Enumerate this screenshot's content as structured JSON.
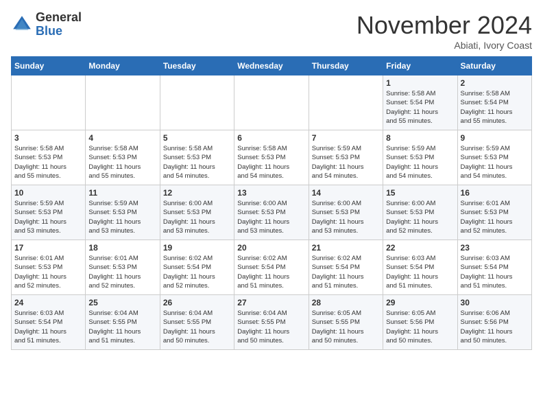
{
  "logo": {
    "general": "General",
    "blue": "Blue"
  },
  "header": {
    "month": "November 2024",
    "location": "Abiati, Ivory Coast"
  },
  "weekdays": [
    "Sunday",
    "Monday",
    "Tuesday",
    "Wednesday",
    "Thursday",
    "Friday",
    "Saturday"
  ],
  "weeks": [
    [
      {
        "day": "",
        "info": ""
      },
      {
        "day": "",
        "info": ""
      },
      {
        "day": "",
        "info": ""
      },
      {
        "day": "",
        "info": ""
      },
      {
        "day": "",
        "info": ""
      },
      {
        "day": "1",
        "info": "Sunrise: 5:58 AM\nSunset: 5:54 PM\nDaylight: 11 hours\nand 55 minutes."
      },
      {
        "day": "2",
        "info": "Sunrise: 5:58 AM\nSunset: 5:54 PM\nDaylight: 11 hours\nand 55 minutes."
      }
    ],
    [
      {
        "day": "3",
        "info": "Sunrise: 5:58 AM\nSunset: 5:53 PM\nDaylight: 11 hours\nand 55 minutes."
      },
      {
        "day": "4",
        "info": "Sunrise: 5:58 AM\nSunset: 5:53 PM\nDaylight: 11 hours\nand 55 minutes."
      },
      {
        "day": "5",
        "info": "Sunrise: 5:58 AM\nSunset: 5:53 PM\nDaylight: 11 hours\nand 54 minutes."
      },
      {
        "day": "6",
        "info": "Sunrise: 5:58 AM\nSunset: 5:53 PM\nDaylight: 11 hours\nand 54 minutes."
      },
      {
        "day": "7",
        "info": "Sunrise: 5:59 AM\nSunset: 5:53 PM\nDaylight: 11 hours\nand 54 minutes."
      },
      {
        "day": "8",
        "info": "Sunrise: 5:59 AM\nSunset: 5:53 PM\nDaylight: 11 hours\nand 54 minutes."
      },
      {
        "day": "9",
        "info": "Sunrise: 5:59 AM\nSunset: 5:53 PM\nDaylight: 11 hours\nand 54 minutes."
      }
    ],
    [
      {
        "day": "10",
        "info": "Sunrise: 5:59 AM\nSunset: 5:53 PM\nDaylight: 11 hours\nand 53 minutes."
      },
      {
        "day": "11",
        "info": "Sunrise: 5:59 AM\nSunset: 5:53 PM\nDaylight: 11 hours\nand 53 minutes."
      },
      {
        "day": "12",
        "info": "Sunrise: 6:00 AM\nSunset: 5:53 PM\nDaylight: 11 hours\nand 53 minutes."
      },
      {
        "day": "13",
        "info": "Sunrise: 6:00 AM\nSunset: 5:53 PM\nDaylight: 11 hours\nand 53 minutes."
      },
      {
        "day": "14",
        "info": "Sunrise: 6:00 AM\nSunset: 5:53 PM\nDaylight: 11 hours\nand 53 minutes."
      },
      {
        "day": "15",
        "info": "Sunrise: 6:00 AM\nSunset: 5:53 PM\nDaylight: 11 hours\nand 52 minutes."
      },
      {
        "day": "16",
        "info": "Sunrise: 6:01 AM\nSunset: 5:53 PM\nDaylight: 11 hours\nand 52 minutes."
      }
    ],
    [
      {
        "day": "17",
        "info": "Sunrise: 6:01 AM\nSunset: 5:53 PM\nDaylight: 11 hours\nand 52 minutes."
      },
      {
        "day": "18",
        "info": "Sunrise: 6:01 AM\nSunset: 5:53 PM\nDaylight: 11 hours\nand 52 minutes."
      },
      {
        "day": "19",
        "info": "Sunrise: 6:02 AM\nSunset: 5:54 PM\nDaylight: 11 hours\nand 52 minutes."
      },
      {
        "day": "20",
        "info": "Sunrise: 6:02 AM\nSunset: 5:54 PM\nDaylight: 11 hours\nand 51 minutes."
      },
      {
        "day": "21",
        "info": "Sunrise: 6:02 AM\nSunset: 5:54 PM\nDaylight: 11 hours\nand 51 minutes."
      },
      {
        "day": "22",
        "info": "Sunrise: 6:03 AM\nSunset: 5:54 PM\nDaylight: 11 hours\nand 51 minutes."
      },
      {
        "day": "23",
        "info": "Sunrise: 6:03 AM\nSunset: 5:54 PM\nDaylight: 11 hours\nand 51 minutes."
      }
    ],
    [
      {
        "day": "24",
        "info": "Sunrise: 6:03 AM\nSunset: 5:54 PM\nDaylight: 11 hours\nand 51 minutes."
      },
      {
        "day": "25",
        "info": "Sunrise: 6:04 AM\nSunset: 5:55 PM\nDaylight: 11 hours\nand 51 minutes."
      },
      {
        "day": "26",
        "info": "Sunrise: 6:04 AM\nSunset: 5:55 PM\nDaylight: 11 hours\nand 50 minutes."
      },
      {
        "day": "27",
        "info": "Sunrise: 6:04 AM\nSunset: 5:55 PM\nDaylight: 11 hours\nand 50 minutes."
      },
      {
        "day": "28",
        "info": "Sunrise: 6:05 AM\nSunset: 5:55 PM\nDaylight: 11 hours\nand 50 minutes."
      },
      {
        "day": "29",
        "info": "Sunrise: 6:05 AM\nSunset: 5:56 PM\nDaylight: 11 hours\nand 50 minutes."
      },
      {
        "day": "30",
        "info": "Sunrise: 6:06 AM\nSunset: 5:56 PM\nDaylight: 11 hours\nand 50 minutes."
      }
    ]
  ]
}
